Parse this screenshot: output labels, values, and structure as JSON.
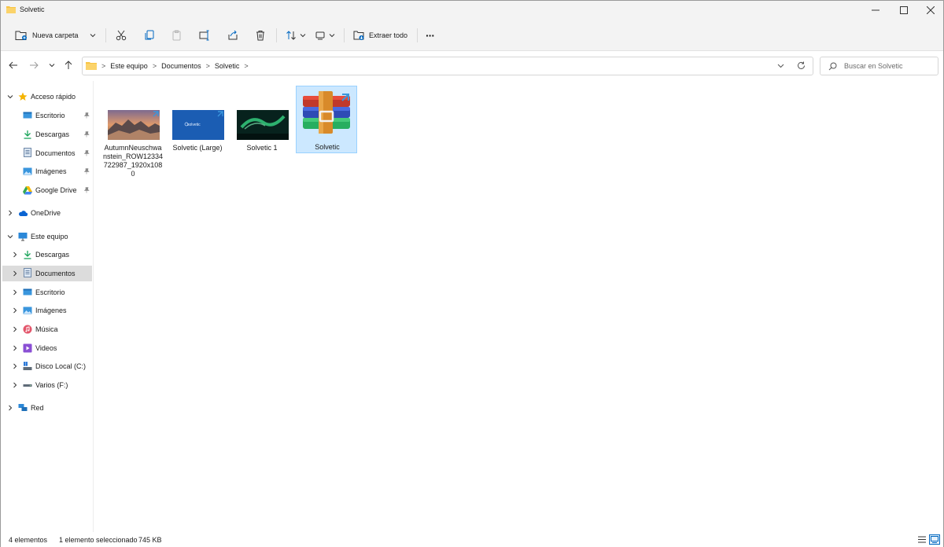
{
  "window": {
    "title": "Solvetic"
  },
  "commands": {
    "new_folder": "Nueva carpeta",
    "extract_all": "Extraer todo",
    "more": "···"
  },
  "address": {
    "crumbs": [
      "Este equipo",
      "Documentos",
      "Solvetic"
    ],
    "separator": ">"
  },
  "search": {
    "placeholder": "Buscar en Solvetic"
  },
  "sidebar": {
    "quick_access": {
      "label": "Acceso rápido",
      "items": [
        {
          "label": "Escritorio",
          "icon": "desktop-icon"
        },
        {
          "label": "Descargas",
          "icon": "download-icon"
        },
        {
          "label": "Documentos",
          "icon": "documents-icon"
        },
        {
          "label": "Imágenes",
          "icon": "pictures-icon"
        },
        {
          "label": "Google Drive",
          "icon": "google-drive-icon"
        }
      ]
    },
    "onedrive": {
      "label": "OneDrive"
    },
    "this_pc": {
      "label": "Este equipo",
      "items": [
        {
          "label": "Descargas",
          "icon": "download-icon"
        },
        {
          "label": "Documentos",
          "icon": "documents-icon",
          "selected": true
        },
        {
          "label": "Escritorio",
          "icon": "desktop-icon"
        },
        {
          "label": "Imágenes",
          "icon": "pictures-icon"
        },
        {
          "label": "Música",
          "icon": "music-icon"
        },
        {
          "label": "Videos",
          "icon": "videos-icon"
        },
        {
          "label": "Disco Local (C:)",
          "icon": "drive-c-icon"
        },
        {
          "label": "Varios (F:)",
          "icon": "drive-f-icon"
        }
      ]
    },
    "network": {
      "label": "Red"
    }
  },
  "files": [
    {
      "name": "AutumnNeuschwanstein_ROW12334722987_1920x1080",
      "type": "image",
      "selected": false
    },
    {
      "name": "Solvetic (Large)",
      "type": "image",
      "selected": false
    },
    {
      "name": "Solvetic 1",
      "type": "image",
      "selected": false
    },
    {
      "name": "Solvetic",
      "type": "rar-archive",
      "selected": true
    }
  ],
  "status": {
    "count": "4 elementos",
    "selection": "1 elemento seleccionado",
    "size": "745 KB"
  },
  "colors": {
    "accent": "#0067c0",
    "selection_bg": "#cce8ff",
    "selection_border": "#99d1ff",
    "folder": "#f8c443"
  }
}
